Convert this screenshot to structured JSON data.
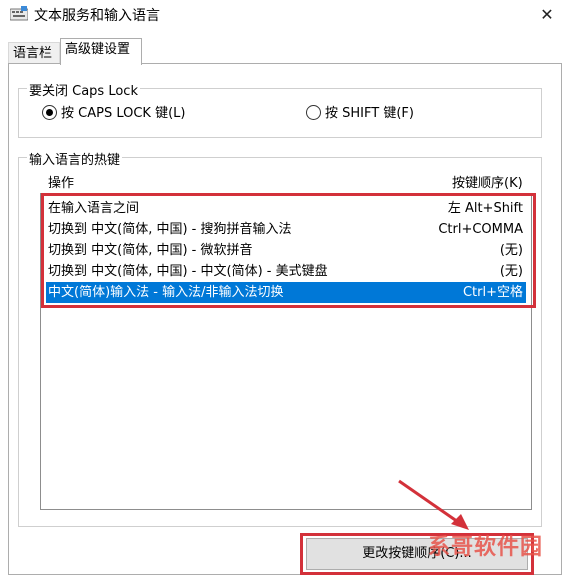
{
  "window": {
    "title": "文本服务和输入语言",
    "close_glyph": "✕"
  },
  "tabs": [
    {
      "label": "语言栏"
    },
    {
      "label": "高级键设置"
    }
  ],
  "caps_lock": {
    "legend": "要关闭 Caps Lock",
    "option_caps": "按 CAPS LOCK 键(L)",
    "option_shift": "按 SHIFT 键(F)",
    "selected": "option_caps"
  },
  "hotkeys": {
    "legend": "输入语言的热键",
    "col_action": "操作",
    "col_keys": "按键顺序(K)",
    "rows": [
      {
        "action": "在输入语言之间",
        "keys": "左 Alt+Shift"
      },
      {
        "action": "切换到 中文(简体, 中国) - 搜狗拼音输入法",
        "keys": "Ctrl+COMMA"
      },
      {
        "action": "切换到 中文(简体, 中国) - 微软拼音",
        "keys": "(无)"
      },
      {
        "action": "切换到 中文(简体, 中国) - 中文(简体) - 美式键盘",
        "keys": "(无)"
      },
      {
        "action": "中文(简体)输入法 - 输入法/非输入法切换",
        "keys": "Ctrl+空格"
      }
    ],
    "selected_index": 4
  },
  "change_button": {
    "label": "更改按键顺序(C)..."
  },
  "watermark": {
    "text": "系哥软件园"
  },
  "colors": {
    "selection": "#0078d7",
    "annotation_red": "#d3313a"
  }
}
